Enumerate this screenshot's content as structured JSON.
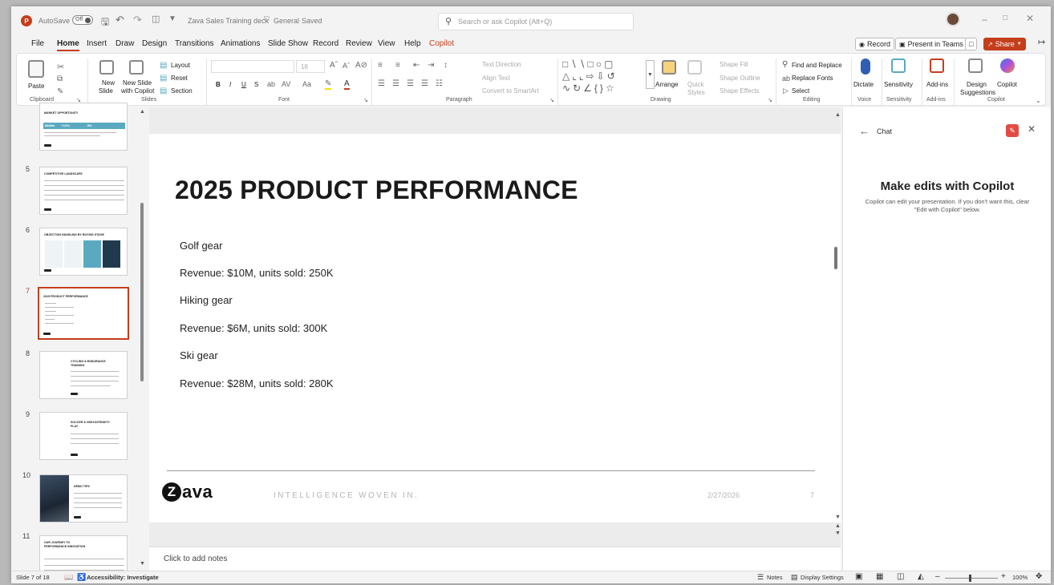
{
  "titlebar": {
    "autosave_label": "AutoSave",
    "autosave_state": "Off",
    "document_name": "Zava Sales Training deck",
    "sensitivity": "General",
    "saved_state": "Saved",
    "search_placeholder": "Search or ask Copilot (Alt+Q)"
  },
  "menu": {
    "tabs": [
      "File",
      "Home",
      "Insert",
      "Draw",
      "Design",
      "Transitions",
      "Animations",
      "Slide Show",
      "Record",
      "Review",
      "View",
      "Help",
      "Copilot"
    ],
    "active_tab": "Home",
    "record": "Record",
    "present_in_teams": "Present in Teams",
    "share": "Share"
  },
  "ribbon": {
    "clipboard": {
      "paste": "Paste",
      "label": "Clipboard"
    },
    "slides": {
      "new_slide_1": "New",
      "new_slide_2": "Slide",
      "new_copilot_1": "New Slide",
      "new_copilot_2": "with Copilot",
      "layout": "Layout",
      "reset": "Reset",
      "section": "Section",
      "label": "Slides"
    },
    "font": {
      "label": "Font",
      "bold": "B",
      "italic": "I",
      "underline": "U",
      "strike": "S",
      "size": "18"
    },
    "paragraph": {
      "label": "Paragraph",
      "text_direction": "Text Direction",
      "align_text": "Align Text",
      "convert_smartart": "Convert to SmartArt"
    },
    "drawing": {
      "label": "Drawing",
      "arrange": "Arrange",
      "quick_styles_1": "Quick",
      "quick_styles_2": "Styles",
      "shape_fill": "Shape Fill",
      "shape_outline": "Shape Outline",
      "shape_effects": "Shape Effects"
    },
    "editing": {
      "label": "Editing",
      "find_replace": "Find and Replace",
      "replace_fonts": "Replace Fonts",
      "select": "Select"
    },
    "voice": {
      "label": "Voice",
      "dictate": "Dictate"
    },
    "sensitivity": {
      "label": "Sensitivity",
      "sensitivity": "Sensitivity"
    },
    "addins": {
      "label": "Add-ins",
      "addins": "Add-ins"
    },
    "copilot": {
      "label": "Copilot",
      "design_1": "Design",
      "design_2": "Suggestions",
      "copilot": "Copilot"
    }
  },
  "thumbnails": [
    {
      "num": "",
      "title": "MARKET OPPORTUNITY"
    },
    {
      "num": "5",
      "title": "COMPETITIVE LANDSCAPE"
    },
    {
      "num": "6",
      "title": "OBJECTION HANDLING BY BUYING STAGE"
    },
    {
      "num": "7",
      "title": "2025 PRODUCT PERFORMANCE"
    },
    {
      "num": "8",
      "title": "CYCLING & ENDURANCE TRAINING"
    },
    {
      "num": "9",
      "title": "SOCCER & HIGH-INTENSITY PLAY"
    },
    {
      "num": "10",
      "title": "DEMO TIPS"
    },
    {
      "num": "11",
      "title": "OUR JOURNEY TO PERFORMANCE INNOVATION"
    }
  ],
  "thumb_stats": [
    "$848m",
    "+12%",
    "8%"
  ],
  "slide": {
    "title": "2025 PRODUCT PERFORMANCE",
    "lines": [
      "Golf gear",
      "Revenue: $10M, units sold: 250K",
      "Hiking gear",
      "Revenue: $6M, units sold: 300K",
      "Ski gear",
      "Revenue: $28M, units sold: 280K"
    ],
    "logo_z": "Z",
    "logo_rest": "ava",
    "tagline": "INTELLIGENCE WOVEN IN.",
    "date": "2/27/2026",
    "page": "7"
  },
  "notes_placeholder": "Click to add notes",
  "copilot_pane": {
    "header": "Chat",
    "title": "Make edits with Copilot",
    "description": "Copilot can edit your presentation. If you don't want this, clear \"Edit with Copilot\" below."
  },
  "status": {
    "slide_of": "Slide 7 of 18",
    "accessibility": "Accessibility: Investigate",
    "notes": "Notes",
    "display_settings": "Display Settings",
    "zoom": "100%"
  },
  "colors": {
    "accent": "#c43e1c",
    "thumb_teal": "#5aa9c1",
    "thumb_navy": "#1f3a4d"
  }
}
